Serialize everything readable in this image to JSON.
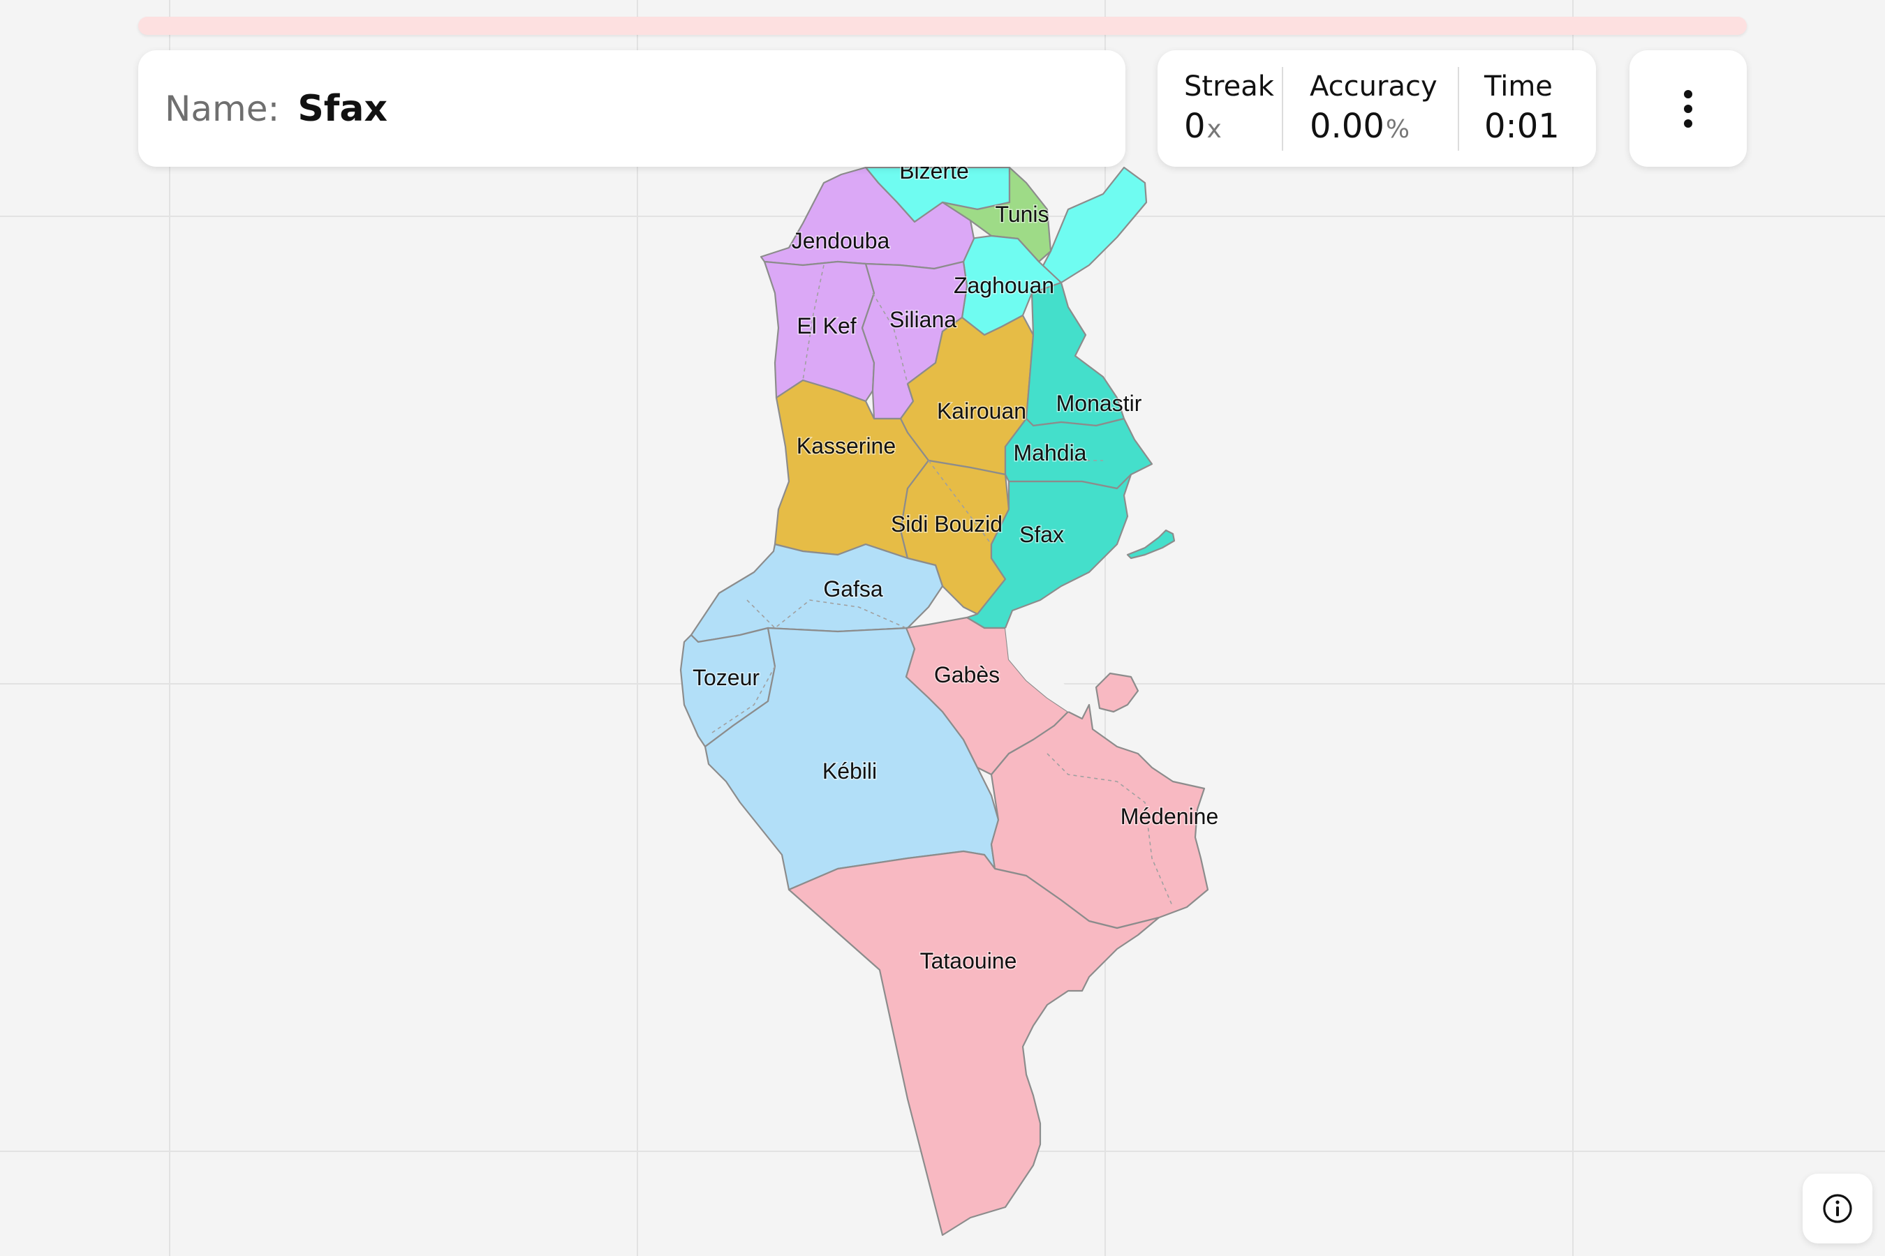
{
  "quiz": {
    "name_label": "Name:",
    "name_value": "Sfax",
    "progress": 0.0
  },
  "stats": {
    "streak_label": "Streak",
    "streak_value": "0",
    "streak_unit": "x",
    "accuracy_label": "Accuracy",
    "accuracy_value": "0.00",
    "accuracy_unit": "%",
    "time_label": "Time",
    "time_value": "0:01"
  },
  "icons": {
    "menu": "kebab-menu-icon",
    "info": "info-icon"
  },
  "colors": {
    "north": "#6ffcf1",
    "tunis": "#9edb87",
    "northwest": "#dba8f6",
    "center": "#e6bc46",
    "coast": "#44dfcb",
    "southwest": "#b2dff8",
    "south": "#f8b9c2"
  },
  "map": {
    "regions": [
      {
        "name": "Bizerte"
      },
      {
        "name": "Tunis"
      },
      {
        "name": "Jendouba"
      },
      {
        "name": "Zaghouan"
      },
      {
        "name": "El Kef"
      },
      {
        "name": "Siliana"
      },
      {
        "name": "Monastir"
      },
      {
        "name": "Kairouan"
      },
      {
        "name": "Kasserine"
      },
      {
        "name": "Mahdia"
      },
      {
        "name": "Sidi Bouzid"
      },
      {
        "name": "Sfax"
      },
      {
        "name": "Gafsa"
      },
      {
        "name": "Gabès"
      },
      {
        "name": "Tozeur"
      },
      {
        "name": "Kébili"
      },
      {
        "name": "Médenine"
      },
      {
        "name": "Tataouine"
      }
    ]
  }
}
